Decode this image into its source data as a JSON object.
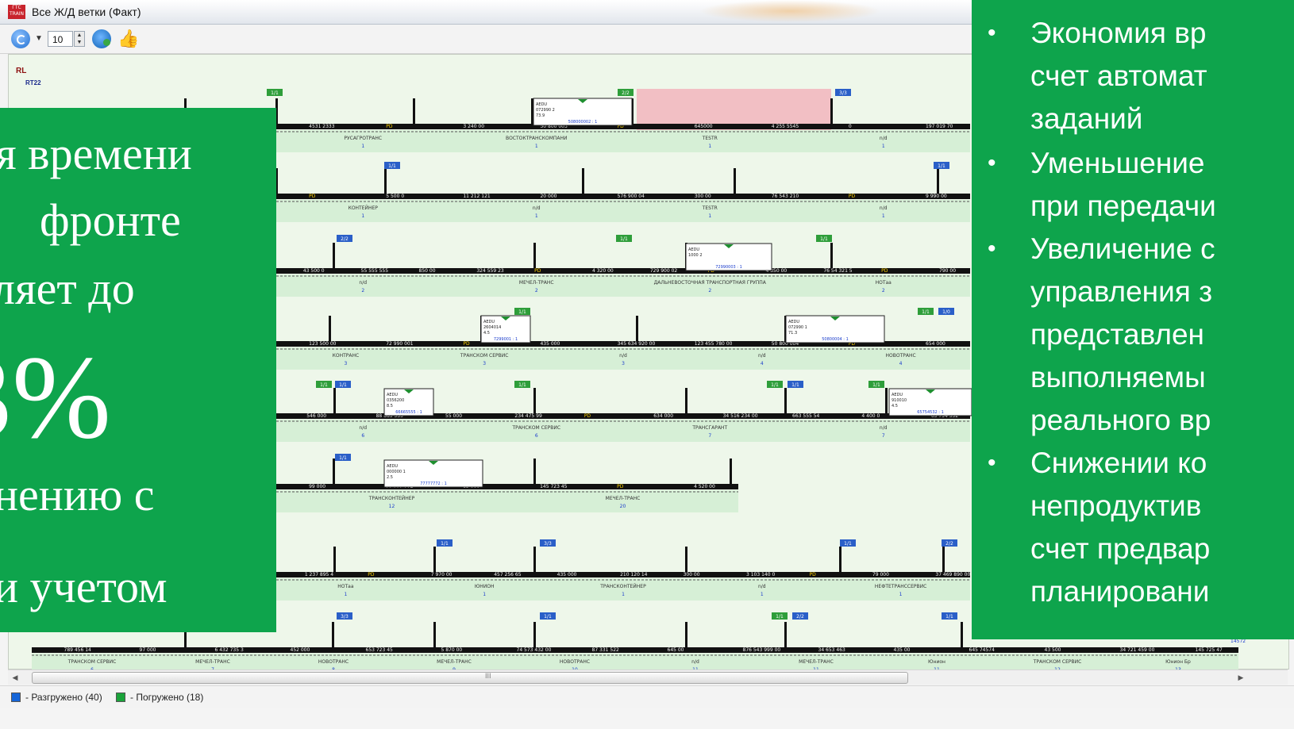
{
  "window": {
    "title": "Все Ж/Д ветки (Факт)",
    "app_icon": "app-icon"
  },
  "toolbar": {
    "count_value": "10",
    "spin_up": "▲",
    "spin_down": "▼",
    "caret": "▼",
    "icons": [
      "refresh-icon",
      "sync-icon",
      "like-icon"
    ]
  },
  "schema": {
    "code_top": "RL",
    "code_sub": "RT22",
    "rows": [
      {
        "fields": [
          "4531 2333",
          "PD",
          "3 240 00",
          "50 800 003",
          "PD",
          "645000",
          "4 255 5545",
          "0",
          "197 019 70"
        ],
        "stations": [
          "РУСАГРОТРАНС",
          "ВОСТОКТРАНСКОМПАНИ",
          "TESTR",
          "n/d"
        ],
        "counts": [
          "1",
          "1",
          "1",
          "1"
        ]
      },
      {
        "fields": [
          "PD",
          "5 500 0",
          "11 212 121",
          "20 000",
          "576 900 04",
          "300 00",
          "76 543 210",
          "PD",
          "9 990 00"
        ],
        "stations": [
          "КОНТЕЙНЕР",
          "n/d",
          "TESTR",
          "n/d"
        ],
        "counts": [
          "1",
          "1",
          "1",
          "1"
        ]
      },
      {
        "fields": [
          "43 500 0",
          "55 555 555",
          "850 00",
          "324 559 23",
          "PD",
          "4 320 00",
          "729 900 02",
          "PD",
          "4 350 00",
          "76 54 321 5",
          "PD",
          "790 00"
        ],
        "stations": [
          "n/d",
          "МЕЧЕЛ-ТРАНС",
          "ДАЛЬНЕВОСТОЧНАЯ ТРАНСПОРТНАЯ ГРУППА",
          "НОТаа"
        ],
        "counts": [
          "2",
          "2",
          "2",
          "2"
        ]
      },
      {
        "fields": [
          "123 500 00",
          "72 990 001",
          "PD",
          "435 000",
          "345 634 920 00",
          "123 455 780 00",
          "50 800 004",
          "PD",
          "654 000"
        ],
        "stations": [
          "КОНТРАНС",
          "ТРАНСКОМ СЕРВИС",
          "n/d",
          "n/d",
          "НОВОТРАНС"
        ],
        "counts": [
          "3",
          "3",
          "3",
          "4",
          "4"
        ]
      },
      {
        "fields": [
          "546 000",
          "88 885 555",
          "55 000",
          "234 475 99",
          "PD",
          "634 000",
          "34 516 234 00",
          "663 555 54",
          "4 400 0",
          "65 754 532"
        ],
        "stations": [
          "n/d",
          "ТРАНСКОМ СЕРВИС",
          "ТРАНСГАРАНТ",
          "n/d"
        ],
        "counts": [
          "6",
          "6",
          "7",
          "7"
        ]
      },
      {
        "fields": [
          "99 000",
          "77 777 772",
          "83 000",
          "145 723 45",
          "PD",
          "4 520 00"
        ],
        "stations": [
          "ТРАНСКОНТЕЙНЕР",
          "МЕЧЕЛ-ТРАНС"
        ],
        "counts": [
          "12",
          "20"
        ]
      },
      {
        "fields": [
          "1 237 895 4",
          "PD",
          "7 970 00",
          "457 256 65",
          "435 000",
          "210 120 14",
          "300 00",
          "3 103 140 0",
          "PD",
          "79 000",
          "37 469 890 00"
        ],
        "stations": [
          "НОТаа",
          "ЮНИОН",
          "ТРАНСКОНТЕЙНЕР",
          "n/d",
          "НЕФТЕТРАНССЕРВИС"
        ],
        "counts": [
          "1",
          "1",
          "1",
          "1",
          "1"
        ]
      },
      {
        "fields": [
          "789 456 14",
          "97 000",
          "6 432 735 3",
          "452 000",
          "653 723 45",
          "5 870 00",
          "74 573 432 00",
          "87 331 522",
          "645 00",
          "876 543 999 00",
          "34 653 463",
          "435 00",
          "645 74574",
          "43 500",
          "34 721 459 00",
          "145 725 47"
        ],
        "stations": [
          "ТРАНСКОМ СЕРВИС",
          "МЕЧЕЛ-ТРАНС",
          "НОВОТРАНС",
          "МЕЧЕЛ-ТРАНС",
          "НОВОТРАНС",
          "n/d",
          "МЕЧЕЛ-ТРАНС",
          "Юнион",
          "ТРАНСКОМ СЕРВИС",
          "Юнион Бр"
        ],
        "counts": [
          "6",
          "7",
          "8",
          "9",
          "10",
          "11",
          "11",
          "11",
          "12",
          "13"
        ]
      }
    ],
    "signal_tags": [
      "1/1",
      "2/2",
      "3/3",
      "1/1",
      "1/1",
      "2/2",
      "1/1",
      "1/1",
      "1/1",
      "1/1",
      "1/0",
      "1/1",
      "1/1",
      "1/1",
      "1/1",
      "1/1",
      "1/1",
      "1/1",
      "1/1",
      "3/3"
    ],
    "wagons": [
      {
        "code": "AEDU",
        "num": "072990 2",
        "note": "73.9",
        "link": "508000002 : 1"
      },
      {
        "code": "AEDU",
        "num": "1000 2",
        "link": "72990003 : 1"
      },
      {
        "code": "AEDU",
        "num": "2604014",
        "note": "4.5",
        "link": "7299001 : 1"
      },
      {
        "code": "AEDU",
        "num": "072990 1",
        "note": "71.3",
        "link": "50800004 : 1"
      },
      {
        "code": "AEDU",
        "num": "0356200",
        "note": "8.5",
        "link": "66665555 : 1"
      },
      {
        "code": "AEDU",
        "num": "910010",
        "note": "4.5",
        "link": "65754532 : 1"
      },
      {
        "code": "AEDU",
        "num": "000000 1",
        "note": "2.5",
        "link": "77777772 : 1"
      }
    ],
    "row_tail_extra": "14572"
  },
  "scrollbar": {
    "left_arrow": "◀",
    "right_arrow": "▶",
    "grip": "III"
  },
  "legend": {
    "unloaded_label": "- Разгружено (40)",
    "loaded_label": "- Погружено (18)",
    "unloaded_color": "#1565d8",
    "loaded_color": "#1aa33a"
  },
  "left_panel": {
    "lines": [
      "я времени",
      "фронте",
      "ляет до"
    ],
    "big": "3%",
    "lines2": [
      "нению с",
      "и учетом"
    ]
  },
  "right_panel": {
    "bullet": "•",
    "lines": [
      "Экономия вр",
      "счет автомат",
      "заданий",
      "Уменьшение",
      "при передачи",
      "Увеличение с",
      "управления з",
      "представлен",
      "выполняемы",
      "реального вр",
      "Снижении ко",
      "непродуктив",
      "счет предвар",
      "планировани"
    ]
  },
  "colors": {
    "panel_green": "#0ea44c",
    "canvas_bg": "#eef7ea",
    "track": "#111111",
    "highlight": "#f2b8c0",
    "tag_green": "#2e9e3a",
    "tag_blue": "#2a5fc8"
  }
}
